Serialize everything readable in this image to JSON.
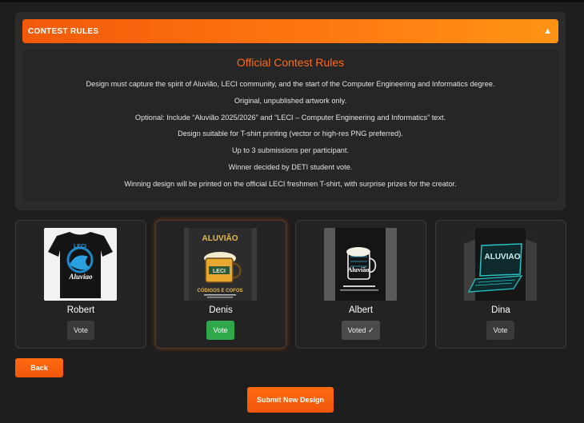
{
  "contest_rules": {
    "header_label": "CONTEST RULES",
    "collapse_arrow": "▲",
    "title": "Official Contest Rules",
    "rules": [
      "Design must capture the spirit of Aluvião, LECI community, and the start of the Computer Engineering and Informatics degree.",
      "Original, unpublished artwork only.",
      "Optional: Include “Aluvião 2025/2026” and “LECI – Computer Engineering and Informatics” text.",
      "Design suitable for T-shirt printing (vector or high-res PNG preferred).",
      "Up to 3 submissions per participant.",
      "Winner decided by DETI student vote.",
      "Winning design will be printed on the official LECI freshmen T-shirt, with surprise prizes for the creator."
    ]
  },
  "designs": [
    {
      "name": "Robert",
      "vote_label": "Vote",
      "state": "default",
      "shirt_text": [
        "LECI",
        "Aluviao"
      ]
    },
    {
      "name": "Denis",
      "vote_label": "Vote",
      "state": "selected",
      "shirt_text": [
        "ALUVIÃO",
        "LECI",
        "CÓDIGOS E COFOS"
      ]
    },
    {
      "name": "Albert",
      "vote_label": "Voted ✓",
      "state": "voted",
      "shirt_text": [
        "Aluvião"
      ]
    },
    {
      "name": "Dina",
      "vote_label": "Vote",
      "state": "default",
      "shirt_text": [
        "ALUVIAO"
      ]
    }
  ],
  "actions": {
    "back_label": "Back",
    "submit_label": "Submit New Design"
  },
  "colors": {
    "accent": "#ff6a10",
    "vote_green": "#2ea84a",
    "background": "#1e1e1e"
  }
}
